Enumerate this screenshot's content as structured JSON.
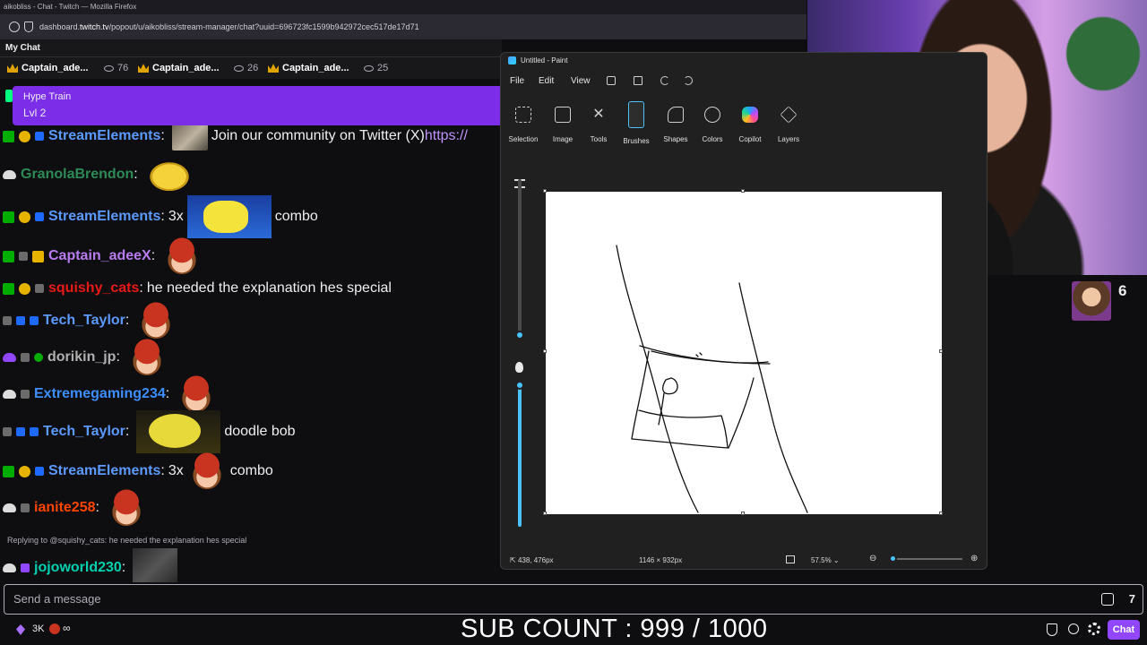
{
  "browser": {
    "title": "aikobliss - Chat - Twitch — Mozilla Firefox",
    "url_prefix": "dashboard.",
    "url_host": "twitch.tv",
    "url_path": "/popout/u/aikobliss/stream-manager/chat?uuid=696723fc1599b942972cec517de17d71"
  },
  "chat": {
    "header": "My Chat",
    "top_viewers": [
      {
        "name": "Captain_ade...",
        "count": "76"
      },
      {
        "name": "Captain_ade...",
        "count": "26"
      },
      {
        "name": "Captain_ade...",
        "count": "25"
      }
    ],
    "hype_train": {
      "title": "Hype Train",
      "level": "Lvl 2"
    },
    "messages": [
      {
        "user": "StreamElements",
        "color": "#5c9aff",
        "pre": "",
        "text": "Join our community on Twitter (X) ",
        "link": "https://"
      },
      {
        "user": "GranolaBrendon",
        "color": "#2e8b57",
        "pre": "",
        "text": "",
        "link": ""
      },
      {
        "user": "StreamElements",
        "color": "#5c9aff",
        "pre": "3x",
        "text": "combo",
        "link": ""
      },
      {
        "user": "Captain_adeeX",
        "color": "#b77df0",
        "pre": "",
        "text": "",
        "link": ""
      },
      {
        "user": "squishy_cats",
        "color": "#e91916",
        "pre": "",
        "text": "he needed the explanation hes special",
        "link": ""
      },
      {
        "user": "Tech_Taylor",
        "color": "#5c9aff",
        "pre": "",
        "text": "",
        "link": ""
      },
      {
        "user": "dorikin_jp",
        "color": "#b0b0b0",
        "pre": "",
        "text": "",
        "link": ""
      },
      {
        "user": "Extremegaming234",
        "color": "#3d8fff",
        "pre": "",
        "text": "",
        "link": ""
      },
      {
        "user": "Tech_Taylor",
        "color": "#5c9aff",
        "pre": "",
        "text": "doodle bob",
        "link": ""
      },
      {
        "user": "StreamElements",
        "color": "#5c9aff",
        "pre": "3x",
        "text": "combo",
        "link": ""
      },
      {
        "user": "ianite258",
        "color": "#ff4500",
        "pre": "",
        "text": "",
        "link": ""
      },
      {
        "user": "jojoworld230",
        "color": "#00d0b0",
        "pre": "",
        "text": "",
        "link": ""
      }
    ],
    "reply_note": "Replying to @squishy_cats: he needed the explanation hes special",
    "send_placeholder": "Send a message",
    "bits_count": "3K",
    "infinity": "∞",
    "chat_button": "Chat"
  },
  "overlay": {
    "sub_count": "SUB COUNT : 999 / 1000",
    "side_count": "6"
  },
  "paint": {
    "title": "Untitled - Paint",
    "menu": [
      "File",
      "Edit",
      "View"
    ],
    "tools": [
      "Selection",
      "Image",
      "Tools",
      "Brushes",
      "Shapes",
      "Colors",
      "Copilot",
      "Layers"
    ],
    "cursor_pos": "438, 476px",
    "canvas_size": "1146 × 932px",
    "zoom": "57.5%"
  },
  "colors": {
    "twitch_purple": "#9147ff",
    "hype": "#7b2de8",
    "paint_accent": "#4cc2ff"
  }
}
